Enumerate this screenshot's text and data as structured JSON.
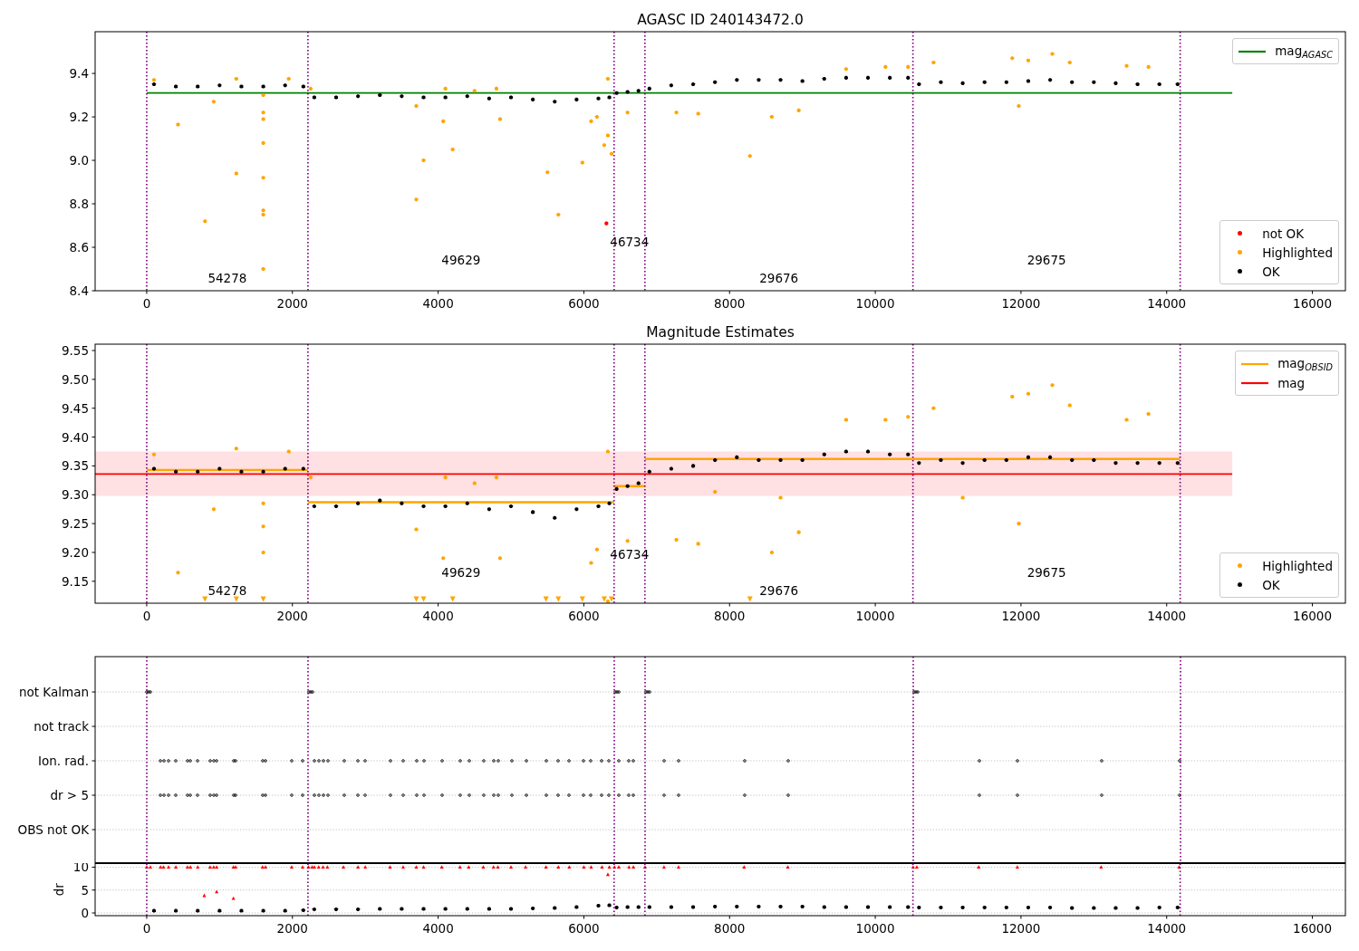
{
  "figure": {
    "panels": [
      {
        "kind": "magnitude",
        "chart_data": {
          "type": "scatter",
          "title": "AGASC ID 240143472.0",
          "xlim": [
            -708,
            16453
          ],
          "ylim": [
            8.4,
            9.592
          ],
          "xticks": [
            0,
            2000,
            4000,
            6000,
            8000,
            10000,
            12000,
            14000,
            16000
          ],
          "yticks": [
            {
              "value": 8.4,
              "label": "8.4"
            },
            {
              "value": 8.6,
              "label": "8.6"
            },
            {
              "value": 8.8,
              "label": "8.8"
            },
            {
              "value": 9.0,
              "label": "9.0"
            },
            {
              "value": 9.2,
              "label": "9.2"
            },
            {
              "value": 9.4,
              "label": "9.4"
            }
          ],
          "series": [
            {
              "name": "mag$_{AGASC}$",
              "type": "line",
              "color": "#008000",
              "x": [
                0,
                14900
              ],
              "values": [
                9.31,
                9.31
              ]
            },
            {
              "name": "not OK",
              "type": "scatter",
              "color": "#ff0000",
              "x": [
                6310
              ],
              "values": [
                8.71
              ]
            },
            {
              "name": "Highlighted",
              "type": "scatter",
              "color": "#ffa500",
              "x": [
                100,
                430,
                800,
                920,
                1230,
                1230,
                1600,
                1600,
                1600,
                1600,
                1600,
                1600,
                1600,
                1600,
                1950,
                2250,
                3700,
                3700,
                3800,
                4070,
                4100,
                4200,
                4500,
                4800,
                4850,
                5500,
                5650,
                5980,
                6100,
                6180,
                6280,
                6330,
                6330,
                6380,
                6600,
                7270,
                7570,
                8280,
                8580,
                8950,
                9600,
                10140,
                10450,
                10800,
                11880,
                11970,
                12100,
                12430,
                12670,
                13450,
                13750
              ],
              "values": [
                9.37,
                9.165,
                8.72,
                9.27,
                8.94,
                9.375,
                9.3,
                9.22,
                9.19,
                9.08,
                8.92,
                8.77,
                8.75,
                8.5,
                9.375,
                9.33,
                9.25,
                8.82,
                9.0,
                9.18,
                9.33,
                9.05,
                9.32,
                9.33,
                9.19,
                8.945,
                8.75,
                8.99,
                9.18,
                9.2,
                9.07,
                9.115,
                9.375,
                9.03,
                9.22,
                9.22,
                9.215,
                9.02,
                9.2,
                9.23,
                9.42,
                9.43,
                9.43,
                9.45,
                9.47,
                9.25,
                9.46,
                9.49,
                9.45,
                9.435,
                9.43
              ]
            },
            {
              "name": "OK",
              "type": "scatter",
              "color": "#000000",
              "x": [
                100,
                400,
                700,
                1000,
                1300,
                1600,
                1900,
                2150,
                2300,
                2600,
                2900,
                3200,
                3500,
                3800,
                4100,
                4400,
                4700,
                5000,
                5300,
                5600,
                5900,
                6200,
                6350,
                6450,
                6600,
                6750,
                6900,
                7200,
                7500,
                7800,
                8100,
                8400,
                8700,
                9000,
                9300,
                9600,
                9900,
                10200,
                10450,
                10600,
                10900,
                11200,
                11500,
                11800,
                12100,
                12400,
                12700,
                13000,
                13300,
                13600,
                13900,
                14150
              ],
              "values": [
                9.35,
                9.34,
                9.34,
                9.345,
                9.34,
                9.34,
                9.345,
                9.34,
                9.29,
                9.29,
                9.295,
                9.3,
                9.295,
                9.29,
                9.29,
                9.295,
                9.285,
                9.29,
                9.28,
                9.27,
                9.28,
                9.285,
                9.29,
                9.31,
                9.315,
                9.32,
                9.33,
                9.345,
                9.35,
                9.36,
                9.37,
                9.37,
                9.37,
                9.365,
                9.375,
                9.38,
                9.38,
                9.38,
                9.38,
                9.35,
                9.36,
                9.355,
                9.36,
                9.36,
                9.365,
                9.37,
                9.36,
                9.36,
                9.355,
                9.35,
                9.35,
                9.35
              ]
            }
          ],
          "ref_lines": [
            {
              "axis": "x",
              "value": 0
            },
            {
              "axis": "x",
              "value": 2213
            },
            {
              "axis": "x",
              "value": 6415
            },
            {
              "axis": "x",
              "value": 6838
            },
            {
              "axis": "x",
              "value": 10517
            },
            {
              "axis": "x",
              "value": 14185
            }
          ],
          "annotations": [
            "54278",
            "49629",
            "46734",
            "29676",
            "29675"
          ]
        }
      },
      {
        "kind": "magnitude",
        "chart_data": {
          "type": "scatter",
          "title": "Magnitude Estimates",
          "xlim": [
            -708,
            16453
          ],
          "ylim": [
            9.112,
            9.561
          ],
          "xticks": [
            0,
            2000,
            4000,
            6000,
            8000,
            10000,
            12000,
            14000,
            16000
          ],
          "yticks": [
            {
              "value": 9.15,
              "label": "9.15"
            },
            {
              "value": 9.2,
              "label": "9.20"
            },
            {
              "value": 9.25,
              "label": "9.25"
            },
            {
              "value": 9.3,
              "label": "9.30"
            },
            {
              "value": 9.35,
              "label": "9.35"
            },
            {
              "value": 9.4,
              "label": "9.40"
            },
            {
              "value": 9.45,
              "label": "9.45"
            },
            {
              "value": 9.5,
              "label": "9.50"
            },
            {
              "value": 9.55,
              "label": "9.55"
            }
          ],
          "series": [
            {
              "name": "mag$_{OBSID}$",
              "type": "line",
              "color": "#ffa500",
              "x": [
                0,
                2213,
                null,
                2213,
                6415,
                null,
                6415,
                6838,
                null,
                6838,
                14185
              ],
              "values": [
                9.343,
                9.343,
                null,
                9.287,
                9.287,
                null,
                9.315,
                9.315,
                null,
                9.362,
                9.362
              ]
            },
            {
              "name": "mag",
              "type": "line",
              "color": "#ff0000",
              "x": [
                -708,
                14900
              ],
              "values": [
                9.336,
                9.336
              ]
            },
            {
              "name": "Highlighted",
              "type": "scatter",
              "color": "#ffa500",
              "x": [
                100,
                430,
                920,
                1230,
                1600,
                1600,
                1600,
                1950,
                2250,
                3700,
                4070,
                4100,
                4500,
                4800,
                4850,
                6100,
                6180,
                6330,
                6330,
                6600,
                7270,
                7570,
                7800,
                8580,
                8700,
                8950,
                9600,
                10140,
                10450,
                10800,
                11200,
                11880,
                11970,
                12100,
                12430,
                12670,
                13450,
                13750
              ],
              "values": [
                9.37,
                9.165,
                9.275,
                9.38,
                9.285,
                9.245,
                9.2,
                9.375,
                9.33,
                9.24,
                9.19,
                9.33,
                9.32,
                9.33,
                9.19,
                9.182,
                9.205,
                9.115,
                9.375,
                9.22,
                9.222,
                9.215,
                9.305,
                9.2,
                9.295,
                9.235,
                9.43,
                9.43,
                9.435,
                9.45,
                9.295,
                9.47,
                9.25,
                9.475,
                9.49,
                9.455,
                9.43,
                9.44
              ]
            },
            {
              "type": "scatter",
              "color": "#ffa500",
              "x": [
                800,
                1230,
                1600,
                3700,
                3800,
                4200,
                5480,
                5650,
                5980,
                6280,
                6380,
                8280
              ],
              "values": [
                9.119,
                9.119,
                9.119,
                9.119,
                9.119,
                9.119,
                9.119,
                9.119,
                9.119,
                9.119,
                9.119,
                9.119
              ]
            },
            {
              "name": "OK",
              "type": "scatter",
              "color": "#000000",
              "x": [
                100,
                400,
                700,
                1000,
                1300,
                1600,
                1900,
                2150,
                2300,
                2600,
                2900,
                3200,
                3500,
                3800,
                4100,
                4400,
                4700,
                5000,
                5300,
                5600,
                5900,
                6200,
                6350,
                6450,
                6600,
                6750,
                6900,
                7200,
                7500,
                7800,
                8100,
                8400,
                8700,
                9000,
                9300,
                9600,
                9900,
                10200,
                10450,
                10600,
                10900,
                11200,
                11500,
                11800,
                12100,
                12400,
                12700,
                13000,
                13300,
                13600,
                13900,
                14150
              ],
              "values": [
                9.345,
                9.34,
                9.34,
                9.345,
                9.34,
                9.34,
                9.345,
                9.345,
                9.28,
                9.28,
                9.285,
                9.29,
                9.285,
                9.28,
                9.28,
                9.285,
                9.275,
                9.28,
                9.27,
                9.26,
                9.275,
                9.28,
                9.285,
                9.31,
                9.315,
                9.32,
                9.34,
                9.345,
                9.35,
                9.36,
                9.365,
                9.36,
                9.36,
                9.36,
                9.37,
                9.375,
                9.375,
                9.37,
                9.37,
                9.355,
                9.36,
                9.355,
                9.36,
                9.36,
                9.365,
                9.365,
                9.36,
                9.36,
                9.355,
                9.355,
                9.355,
                9.355
              ]
            }
          ],
          "bands": [
            {
              "axis": "y",
              "from": 9.298,
              "to": 9.375
            }
          ],
          "ref_lines": [
            {
              "axis": "x",
              "value": 0
            },
            {
              "axis": "x",
              "value": 2213
            },
            {
              "axis": "x",
              "value": 6415
            },
            {
              "axis": "x",
              "value": 6838
            },
            {
              "axis": "x",
              "value": 10517
            },
            {
              "axis": "x",
              "value": 14185
            }
          ],
          "annotations": [
            "54278",
            "49629",
            "46734",
            "29676",
            "29675"
          ]
        }
      },
      {
        "kind": "flags",
        "rows": [
          {
            "label": "not Kalman"
          },
          {
            "label": "not track"
          },
          {
            "label": "Ion. rad."
          },
          {
            "label": "dr > 5"
          },
          {
            "label": "OBS not OK"
          }
        ]
      },
      {
        "kind": "dr",
        "chart_data": {
          "type": "scatter",
          "ylabel": "dr",
          "grid": true,
          "xlim": [
            -708,
            16453
          ],
          "ylim": [
            -0.59,
            10.78
          ],
          "xticks": [
            0,
            2000,
            4000,
            6000,
            8000,
            10000,
            12000,
            14000,
            16000
          ],
          "yticks": [
            {
              "value": 0,
              "label": "0"
            },
            {
              "value": 5,
              "label": "5"
            },
            {
              "value": 10,
              "label": "10"
            }
          ],
          "series": [
            {
              "color": "#000000",
              "x": [
                100,
                400,
                700,
                1000,
                1300,
                1600,
                1900,
                2150,
                2300,
                2600,
                2900,
                3200,
                3500,
                3800,
                4100,
                4400,
                4700,
                5000,
                5300,
                5600,
                5900,
                6200,
                6350,
                6450,
                6600,
                6750,
                6900,
                7200,
                7500,
                7800,
                8100,
                8400,
                8700,
                9000,
                9300,
                9600,
                9900,
                10200,
                10450,
                10600,
                10900,
                11200,
                11500,
                11800,
                12100,
                12400,
                12700,
                13000,
                13300,
                13600,
                13900,
                14150
              ],
              "values": [
                0.5,
                0.5,
                0.5,
                0.5,
                0.5,
                0.5,
                0.5,
                0.6,
                0.8,
                0.8,
                0.8,
                0.9,
                0.9,
                0.9,
                0.9,
                0.9,
                0.9,
                0.9,
                1.0,
                1.1,
                1.3,
                1.6,
                1.7,
                1.2,
                1.3,
                1.3,
                1.3,
                1.3,
                1.3,
                1.4,
                1.4,
                1.4,
                1.4,
                1.4,
                1.3,
                1.3,
                1.3,
                1.3,
                1.3,
                1.2,
                1.2,
                1.2,
                1.2,
                1.2,
                1.2,
                1.2,
                1.1,
                1.1,
                1.1,
                1.1,
                1.2,
                1.2
              ]
            },
            {
              "color": "#ff0000",
              "x": [
                0,
                50,
                2220,
                2270,
                6420,
                6840,
                10520,
                10570,
                190,
                230,
                300,
                400,
                560,
                600,
                700,
                870,
                920,
                960,
                1190,
                1220,
                1590,
                1630,
                1990,
                2140,
                2300,
                2360,
                2420,
                2480,
                2700,
                2900,
                3000,
                3340,
                3520,
                3700,
                3800,
                4050,
                4300,
                4420,
                4620,
                4760,
                4820,
                5000,
                5200,
                5480,
                5650,
                5800,
                6000,
                6100,
                6250,
                6350,
                6480,
                6620,
                6680,
                7100,
                7300,
                8200,
                8800,
                11420,
                11950,
                13100,
                14170,
                790,
                960,
                1190,
                6330
              ],
              "values": [
                10,
                10,
                10,
                10,
                10,
                10,
                10,
                10,
                10,
                10,
                10,
                10,
                10,
                10,
                10,
                10,
                10,
                10,
                10,
                10,
                10,
                10,
                10,
                10,
                10,
                10,
                10,
                10,
                10,
                10,
                10,
                10,
                10,
                10,
                10,
                10,
                10,
                10,
                10,
                10,
                10,
                10,
                10,
                10,
                10,
                10,
                10,
                10,
                10,
                10,
                10,
                10,
                10,
                10,
                10,
                10,
                10,
                10,
                10,
                10,
                10,
                3.8,
                4.6,
                3.2,
                8.4
              ]
            }
          ],
          "ref_lines": [
            {
              "axis": "x",
              "value": 0
            },
            {
              "axis": "x",
              "value": 2213
            },
            {
              "axis": "x",
              "value": 6415
            },
            {
              "axis": "x",
              "value": 6838
            },
            {
              "axis": "x",
              "value": 10517
            },
            {
              "axis": "x",
              "value": 14185
            }
          ]
        }
      }
    ]
  }
}
